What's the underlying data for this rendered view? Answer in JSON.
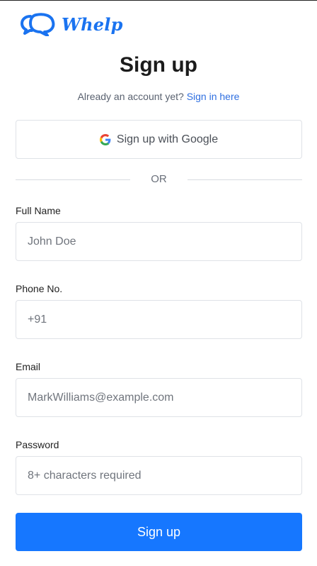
{
  "brand": {
    "name": "Whelp",
    "icon": "chat-bubbles-icon",
    "color": "#1a73f0"
  },
  "header": {
    "title": "Sign up",
    "subtitle_text": "Already an account yet?",
    "signin_link": "Sign in here"
  },
  "google": {
    "label": "Sign up with Google",
    "icon": "google-icon"
  },
  "divider": {
    "text": "OR"
  },
  "form": {
    "full_name": {
      "label": "Full Name",
      "placeholder": "John Doe",
      "value": ""
    },
    "phone": {
      "label": "Phone No.",
      "placeholder": "+91",
      "value": ""
    },
    "email": {
      "label": "Email",
      "placeholder": "MarkWilliams@example.com",
      "value": ""
    },
    "password": {
      "label": "Password",
      "placeholder": "8+ characters required",
      "value": ""
    }
  },
  "submit": {
    "label": "Sign up",
    "color": "#1677ff"
  },
  "colors": {
    "link": "#2f6fe0",
    "border": "#dfe2e7"
  }
}
